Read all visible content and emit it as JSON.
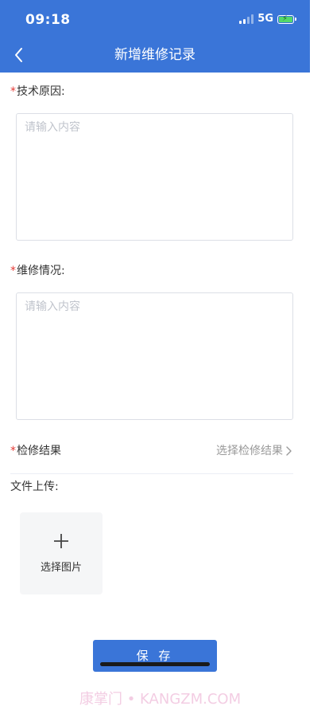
{
  "status_bar": {
    "time": "09:18",
    "network": "5G"
  },
  "nav": {
    "title": "新增维修记录"
  },
  "form": {
    "required_mark": "*",
    "tech_reason": {
      "label": "技术原因:",
      "placeholder": "请输入内容"
    },
    "repair_situation": {
      "label": "维修情况:",
      "placeholder": "请输入内容"
    },
    "inspection_result": {
      "label": "检修结果",
      "placeholder": "选择检修结果"
    },
    "file_upload": {
      "label": "文件上传:",
      "button_label": "选择图片"
    },
    "save_label": "保 存"
  },
  "watermark": "康掌门 • KANGZM.COM",
  "colors": {
    "primary": "#3a75d8",
    "required": "#e53935",
    "placeholder": "#c0c4cc"
  }
}
